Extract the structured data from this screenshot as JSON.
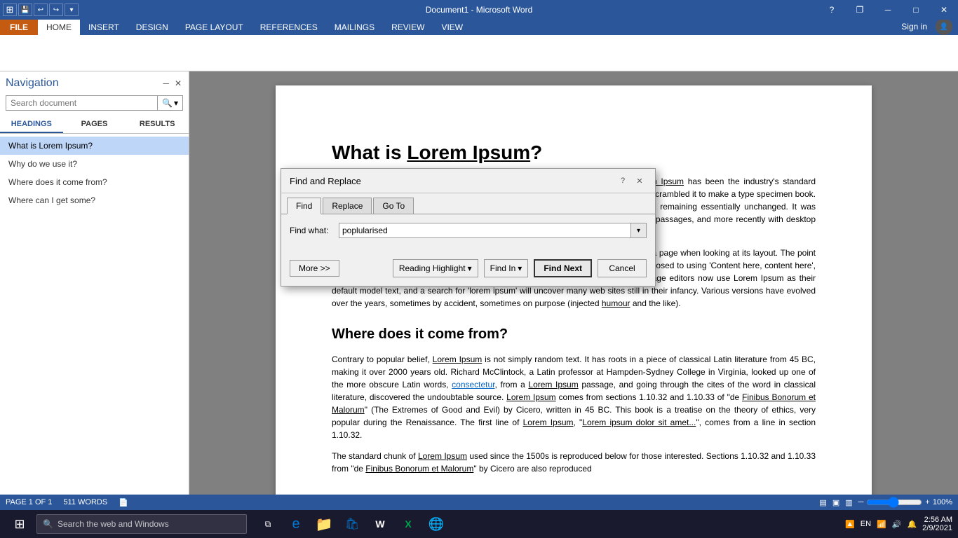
{
  "titleBar": {
    "title": "Document1 - Microsoft Word",
    "helpBtn": "?",
    "restoreBtn": "❐",
    "minimizeBtn": "─",
    "maximizeBtn": "□",
    "closeBtn": "✕"
  },
  "ribbonTabs": [
    {
      "label": "FILE",
      "class": "file"
    },
    {
      "label": "HOME",
      "class": "active"
    },
    {
      "label": "INSERT",
      "class": ""
    },
    {
      "label": "DESIGN",
      "class": ""
    },
    {
      "label": "PAGE LAYOUT",
      "class": ""
    },
    {
      "label": "REFERENCES",
      "class": ""
    },
    {
      "label": "MAILINGS",
      "class": ""
    },
    {
      "label": "REVIEW",
      "class": ""
    },
    {
      "label": "VIEW",
      "class": ""
    }
  ],
  "signIn": "Sign in",
  "sidebar": {
    "title": "Navigation",
    "pinBtn": "─",
    "closeBtn": "✕",
    "searchPlaceholder": "Search document",
    "tabs": [
      {
        "label": "HEADINGS",
        "active": true
      },
      {
        "label": "PAGES",
        "active": false
      },
      {
        "label": "RESULTS",
        "active": false
      }
    ],
    "headings": [
      {
        "label": "What is Lorem Ipsum?",
        "active": true,
        "sub": false
      },
      {
        "label": "Why do we use it?",
        "active": false,
        "sub": false
      },
      {
        "label": "Where does it come from?",
        "active": false,
        "sub": false
      },
      {
        "label": "Where can I get some?",
        "active": false,
        "sub": false
      }
    ]
  },
  "document": {
    "title": "What is Lorem Ipsum?",
    "paragraphs": [
      "Lorem Ipsum is simply dummy text of the printing and typesetting industry. Lorem Ipsum has been the industry's standard dummy text ever since the 1500s, when an unknown printer took a galley of type and scrambled it to make a type specimen book. It has survived not only five centuries, but also the leap into electronic typesetting, remaining essentially unchanged. It was popularised in the 1960s with the release of Letraset sheets containing Lorem Ipsum passages, and more recently with desktop publishing software like Aldus PageMaker including versions of Lorem Ipsum.",
      "It is a long established fact that a reader will be distracted by the readable content of a page when looking at its layout. The point of using Lorem Ipsum is that it has a more-or-less normal distribution of letters, as opposed to using 'Content here, content here', making it look like readable English. Many desktop publishing packages and web page editors now use Lorem Ipsum as their default model text, and a search for 'lorem ipsum' will uncover many web sites still in their infancy. Various versions have evolved over the years, sometimes by accident, sometimes on purpose (injected humour and the like)."
    ],
    "section2Title": "Where does it come from?",
    "section2Para1": "Contrary to popular belief, Lorem Ipsum is not simply random text. It has roots in a piece of classical Latin literature from 45 BC, making it over 2000 years old. Richard McClintock, a Latin professor at Hampden-Sydney College in Virginia, looked up one of the more obscure Latin words, consectetur, from a Lorem Ipsum passage, and going through the cites of the word in classical literature, discovered the undoubtable source. Lorem Ipsum comes from sections 1.10.32 and 1.10.33 of \"de Finibus Bonorum et Malorum\" (The Extremes of Good and Evil) by Cicero, written in 45 BC. This book is a treatise on the theory of ethics, very popular during the Renaissance. The first line of Lorem Ipsum, \"Lorem ipsum dolor sit amet...\", comes from a line in section 1.10.32.",
    "section2Para2": "The standard chunk of Lorem Ipsum used since the 1500s is reproduced below for those interested. Sections 1.10.32 and 1.10.33 from \"de Finibus Bonorum et Malorum\" by Cicero are also reproduced"
  },
  "dialog": {
    "title": "Find and Replace",
    "tabs": [
      {
        "label": "Find",
        "active": true
      },
      {
        "label": "Replace",
        "active": false
      },
      {
        "label": "Go To",
        "active": false
      }
    ],
    "findLabel": "Find what:",
    "findValue": "poplularised",
    "moreBtn": "More >>",
    "readingHighlightBtn": "Reading Highlight",
    "findInBtn": "Find In",
    "findNextBtn": "Find Next",
    "cancelBtn": "Cancel"
  },
  "statusBar": {
    "page": "PAGE 1 OF 1",
    "words": "511 WORDS",
    "zoom": "100%"
  },
  "taskbar": {
    "searchPlaceholder": "Search the web and Windows",
    "time": "2:56 AM",
    "date": "2/9/2021"
  }
}
